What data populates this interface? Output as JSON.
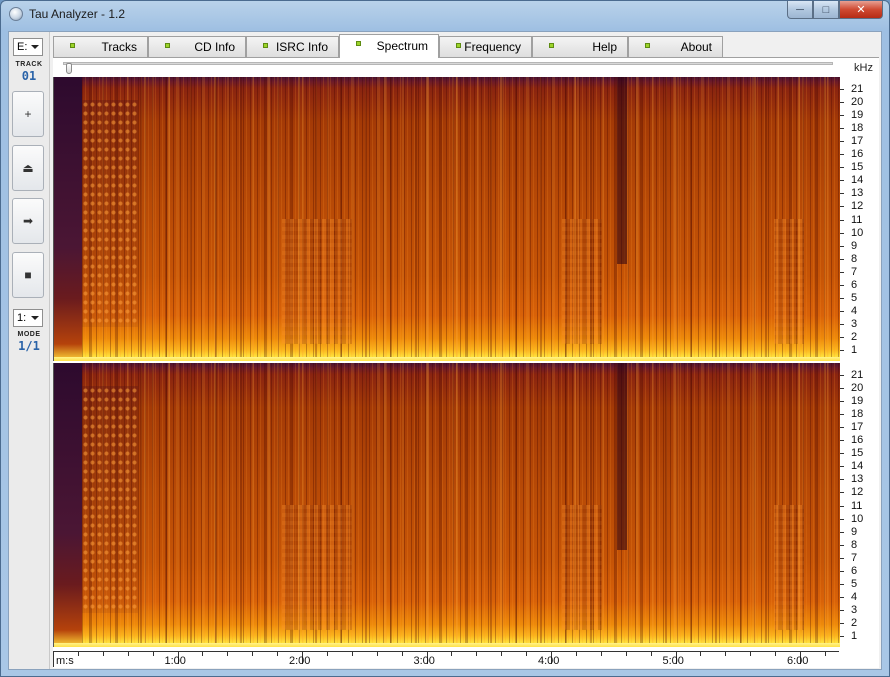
{
  "window": {
    "title": "Tau Analyzer - 1.2",
    "min_glyph": "─",
    "max_glyph": "□",
    "close_glyph": "✕"
  },
  "sidebar": {
    "drive": "E:",
    "track_label": "TRACK",
    "track_value": "01",
    "buttons": [
      {
        "name": "add-button",
        "glyph": "+"
      },
      {
        "name": "eject-button",
        "glyph": "⏏"
      },
      {
        "name": "play-button",
        "glyph": "➡"
      },
      {
        "name": "stop-button",
        "glyph": "■"
      }
    ],
    "mode_select": "1:",
    "mode_label": "MODE",
    "mode_value": "1/1"
  },
  "tabs": [
    {
      "label": "Tracks",
      "active": false
    },
    {
      "label": "CD Info",
      "active": false
    },
    {
      "label": "ISRC Info",
      "active": false
    },
    {
      "label": "Spectrum",
      "active": true
    },
    {
      "label": "Frequency",
      "active": false
    },
    {
      "label": "Help",
      "active": false
    },
    {
      "label": "About",
      "active": false
    }
  ],
  "spectrum": {
    "y_unit": "kHz",
    "y_ticks": [
      "21",
      "20",
      "19",
      "18",
      "17",
      "16",
      "15",
      "14",
      "13",
      "12",
      "11",
      "10",
      "9",
      "8",
      "7",
      "6",
      "5",
      "4",
      "3",
      "2",
      "1"
    ],
    "x_start_label": "m:s",
    "x_ticks": [
      "1:00",
      "2:00",
      "3:00",
      "4:00",
      "5:00",
      "6:00"
    ],
    "channels": [
      "left",
      "right"
    ],
    "position_fraction": 0
  }
}
